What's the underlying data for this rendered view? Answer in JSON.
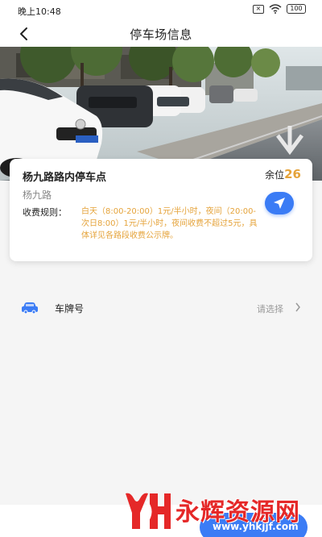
{
  "status_bar": {
    "time": "晚上10:48",
    "battery": "100",
    "icons": [
      "sim-card-icon",
      "wifi-icon",
      "battery-icon"
    ]
  },
  "header": {
    "title": "停车场信息",
    "back_icon": "back-arrow-icon"
  },
  "parking_lot": {
    "name": "杨九路路内停车点",
    "spaces_label": "余位",
    "spaces_count": "26",
    "address": "杨九路",
    "rule_label": "收费规则：",
    "rule_text": "白天（8:00-20:00）1元/半小时，夜间（20:00-次日8:00）1元/半小时，夜间收费不超过5元，具体详见各路段收费公示牌。",
    "navigate_icon": "navigation-arrow-icon"
  },
  "plate_row": {
    "label": "车牌号",
    "placeholder": "请选择",
    "icon": "car-icon"
  },
  "watermark": {
    "text": "永辉资源网",
    "url": "www.yhkjjf.com"
  },
  "colors": {
    "accent_blue": "#3b7cf5",
    "highlight_orange": "#e5a33a",
    "watermark_red": "#e52828"
  }
}
